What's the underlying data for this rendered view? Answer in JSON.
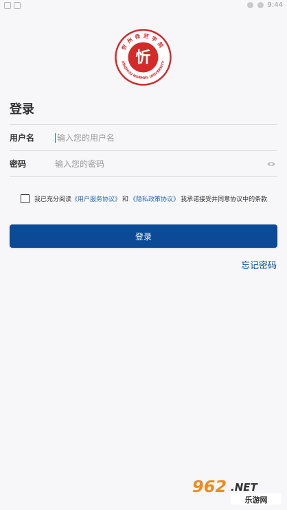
{
  "statusbar": {
    "time": "9:44"
  },
  "logo": {
    "text_top": "忻州师范学院",
    "text_bottom": "XINZHOU NORMAL UNIVERSITY",
    "glyph": "忻",
    "color": "#d42a2a"
  },
  "form": {
    "title": "登录",
    "username": {
      "label": "用户名",
      "placeholder": "输入您的用户名"
    },
    "password": {
      "label": "密码",
      "placeholder": "输入您的密码"
    }
  },
  "agreement": {
    "prefix": "我已充分阅读",
    "service_link": "《用户服务协议》",
    "and": "和",
    "privacy_link": "《隐私政策协议》",
    "suffix": "我承诺接受并同意协议中的条款"
  },
  "buttons": {
    "login": "登录",
    "forgot": "忘记密码"
  },
  "watermark": {
    "brand": "962",
    "dot_net": ".NET",
    "subtitle": "乐游网"
  },
  "colors": {
    "primary": "#0b4a97",
    "link": "#2a6bb0",
    "background": "#f7f7f9"
  }
}
